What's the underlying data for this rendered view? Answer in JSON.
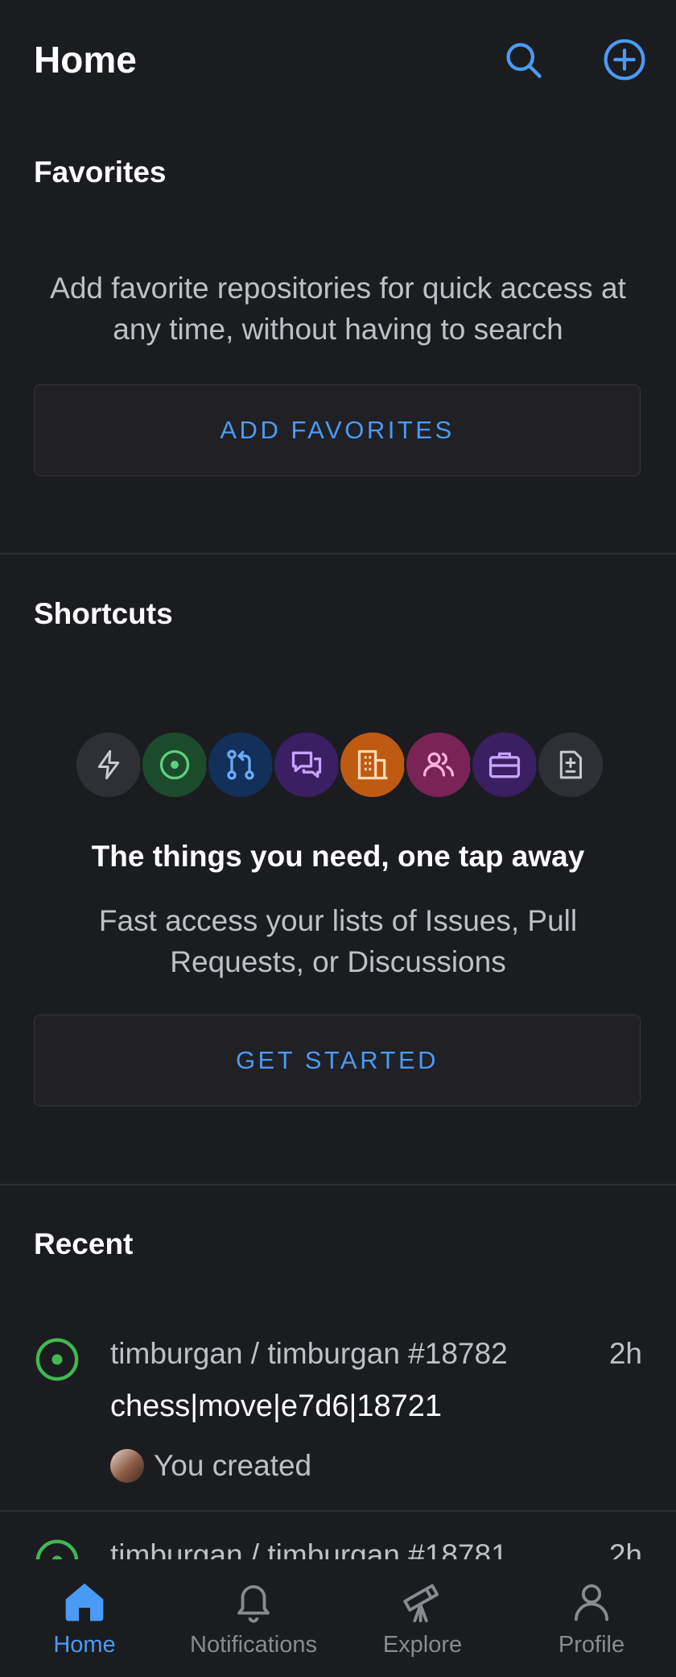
{
  "header": {
    "title": "Home",
    "search_icon": "search-icon",
    "add_icon": "plus-circle-icon"
  },
  "favorites": {
    "title": "Favorites",
    "description": "Add favorite repositories for quick access at any time, without having to search",
    "button_label": "ADD FAVORITES"
  },
  "shortcuts": {
    "title": "Shortcuts",
    "icons": [
      {
        "name": "zap-icon",
        "bg": "#2f3036",
        "fg": "#c9cace"
      },
      {
        "name": "issue-opened-icon",
        "bg": "#1c4b2c",
        "fg": "#5fd07e"
      },
      {
        "name": "git-pull-request-icon",
        "bg": "#12305a",
        "fg": "#6aaaf8"
      },
      {
        "name": "discussions-icon",
        "bg": "#3a1f62",
        "fg": "#c6a3ff"
      },
      {
        "name": "organization-icon",
        "bg": "#bf5a12",
        "fg": "#ffd9b5"
      },
      {
        "name": "people-icon",
        "bg": "#7a2357",
        "fg": "#ffb2de"
      },
      {
        "name": "briefcase-icon",
        "bg": "#3a1f62",
        "fg": "#c6a3ff"
      },
      {
        "name": "diff-icon",
        "bg": "#2f3036",
        "fg": "#c9cace"
      }
    ],
    "tagline": "The things you need, one tap away",
    "description": "Fast access your lists of Issues, Pull Requests, or Discussions",
    "button_label": "GET STARTED"
  },
  "recent": {
    "title": "Recent",
    "items": [
      {
        "repo": "timburgan / timburgan #18782",
        "time": "2h",
        "title": "chess|move|e7d6|18721",
        "meta": "You created",
        "status_icon": "issue-opened-icon",
        "status_color": "#3fb950"
      },
      {
        "repo": "timburgan / timburgan #18781",
        "time": "2h",
        "status_icon": "issue-opened-icon",
        "status_color": "#3fb950"
      }
    ]
  },
  "tabs": [
    {
      "label": "Home",
      "icon": "home-icon",
      "active": true
    },
    {
      "label": "Notifications",
      "icon": "bell-icon",
      "active": false
    },
    {
      "label": "Explore",
      "icon": "telescope-icon",
      "active": false
    },
    {
      "label": "Profile",
      "icon": "person-icon",
      "active": false
    }
  ],
  "colors": {
    "background": "#1b1c20",
    "accent": "#4a9bf5",
    "muted_text": "#bfc0c5",
    "border": "#34353b"
  }
}
